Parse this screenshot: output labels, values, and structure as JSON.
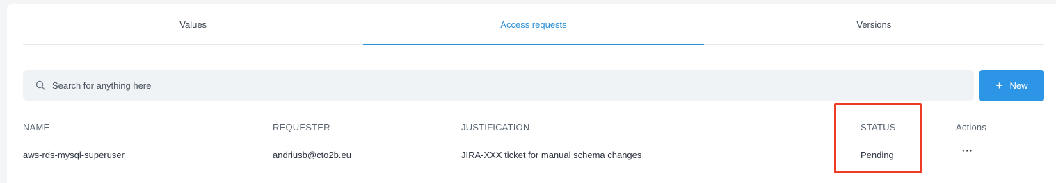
{
  "tabs": [
    {
      "label": "Values"
    },
    {
      "label": "Access requests"
    },
    {
      "label": "Versions"
    }
  ],
  "search": {
    "placeholder": "Search for anything here",
    "icon": "search-icon"
  },
  "new_button": {
    "label": "New",
    "icon": "plus-icon"
  },
  "table": {
    "headers": {
      "name": "NAME",
      "requester": "REQUESTER",
      "justification": "JUSTIFICATION",
      "status": "STATUS",
      "actions": "Actions"
    },
    "rows": [
      {
        "name": "aws-rds-mysql-superuser",
        "requester": "andriusb@cto2b.eu",
        "justification": "JIRA-XXX ticket for manual schema changes",
        "status": "Pending",
        "actions": "···"
      }
    ]
  },
  "colors": {
    "accent": "#2b8fd6",
    "button": "#2d95e6",
    "highlight": "#ef3b24"
  }
}
